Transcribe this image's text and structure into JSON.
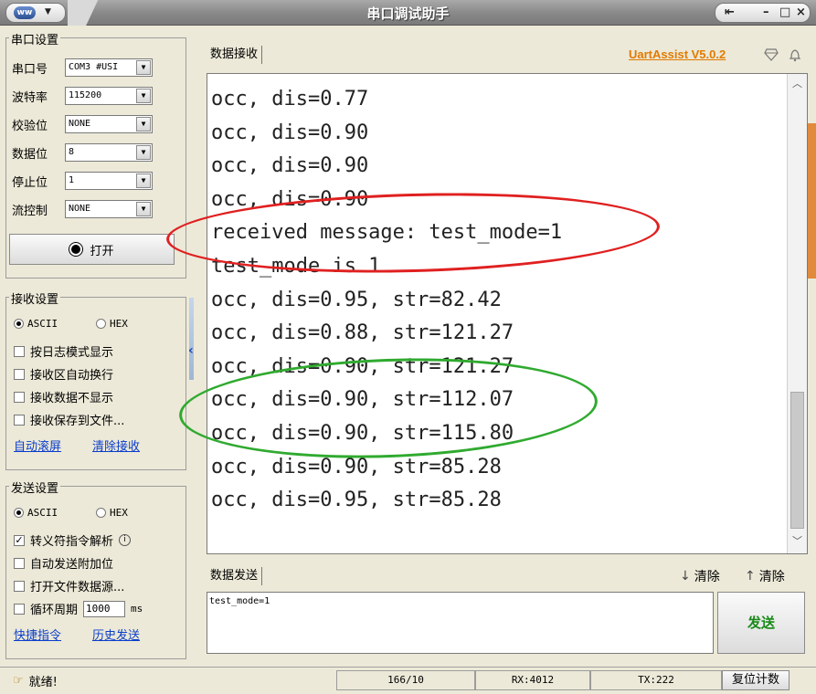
{
  "window": {
    "title": "串口调试助手",
    "menu_logo": "ᴡᴡ",
    "buttons": {
      "pin": "⇤",
      "minimize": "–",
      "maximize": "□",
      "close": "×"
    }
  },
  "serial_settings": {
    "title": "串口设置",
    "fields": [
      {
        "label": "串口号",
        "value": "COM3 #USI"
      },
      {
        "label": "波特率",
        "value": "115200"
      },
      {
        "label": "校验位",
        "value": "NONE"
      },
      {
        "label": "数据位",
        "value": "8"
      },
      {
        "label": "停止位",
        "value": "1"
      },
      {
        "label": "流控制",
        "value": "NONE"
      }
    ],
    "open_button": "打开"
  },
  "receive_settings": {
    "title": "接收设置",
    "radio_ascii": "ASCII",
    "radio_hex": "HEX",
    "selected": "ASCII",
    "options": [
      {
        "label": "按日志模式显示",
        "checked": false
      },
      {
        "label": "接收区自动换行",
        "checked": false
      },
      {
        "label": "接收数据不显示",
        "checked": false
      },
      {
        "label": "接收保存到文件...",
        "checked": false
      }
    ],
    "link_autoscroll": "自动滚屏",
    "link_clear": "清除接收"
  },
  "send_settings": {
    "title": "发送设置",
    "radio_ascii": "ASCII",
    "radio_hex": "HEX",
    "selected": "ASCII",
    "opt_escape": "转义符指令解析",
    "opt_escape_checked": true,
    "opt_autoappend": "自动发送附加位",
    "opt_openfile": "打开文件数据源...",
    "opt_loop": "循环周期",
    "loop_value": "1000",
    "loop_unit": "ms",
    "link_shortcut": "快捷指令",
    "link_history": "历史发送"
  },
  "receive_area": {
    "tab_label": "数据接收",
    "version": "UartAssist V5.0.2",
    "lines": [
      "occ, dis=0.77",
      "occ, dis=0.90",
      "occ, dis=0.90",
      "occ, dis=0.90",
      "received message: test_mode=1",
      "test_mode is 1",
      "occ, dis=0.95, str=82.42",
      "occ, dis=0.88, str=121.27",
      "occ, dis=0.90, str=121.27",
      "occ, dis=0.90, str=112.07",
      "occ, dis=0.90, str=115.80",
      "occ, dis=0.90, str=85.28",
      "occ, dis=0.95, str=85.28"
    ],
    "highlight_red_color": "#e02020",
    "highlight_green_color": "#2faa2f"
  },
  "send_area": {
    "tab_label": "数据发送",
    "clear_1": "清除",
    "clear_2": "清除",
    "input_value": "test_mode=1",
    "send_button": "发送"
  },
  "status_bar": {
    "ready": "就绪!",
    "counter": "166/10",
    "rx": "RX:4012",
    "tx": "TX:222",
    "reset": "复位计数"
  }
}
